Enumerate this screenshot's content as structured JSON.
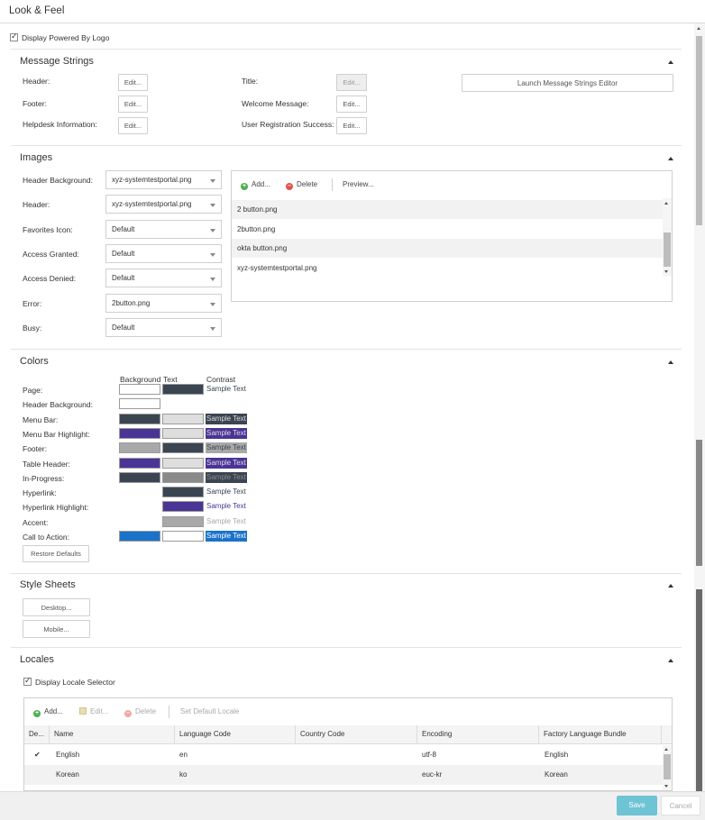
{
  "page": {
    "title": "Look & Feel"
  },
  "powered_by": {
    "label": "Display Powered By Logo",
    "checked": true
  },
  "message_strings": {
    "title": "Message Strings",
    "items": [
      {
        "label": "Header:",
        "button": "Edit...",
        "enabled": true
      },
      {
        "label": "Footer:",
        "button": "Edit...",
        "enabled": true
      },
      {
        "label": "Helpdesk Information:",
        "button": "Edit...",
        "enabled": true
      },
      {
        "label": "Title:",
        "button": "Edit...",
        "enabled": false
      },
      {
        "label": "Welcome Message:",
        "button": "Edit...",
        "enabled": true
      },
      {
        "label": "User Registration Success:",
        "button": "Edit...",
        "enabled": true
      }
    ],
    "launch_button": "Launch Message Strings Editor"
  },
  "images": {
    "title": "Images",
    "fields": [
      {
        "label": "Header Background:",
        "value": "xyz-systemtestportal.png"
      },
      {
        "label": "Header:",
        "value": "xyz-systemtestportal.png"
      },
      {
        "label": "Favorites Icon:",
        "value": "Default"
      },
      {
        "label": "Access Granted:",
        "value": "Default"
      },
      {
        "label": "Access Denied:",
        "value": "Default"
      },
      {
        "label": "Error:",
        "value": "2button.png"
      },
      {
        "label": "Busy:",
        "value": "Default"
      }
    ],
    "toolbar": {
      "add": "Add...",
      "delete": "Delete",
      "preview": "Preview..."
    },
    "files": [
      "2 button.png",
      "2button.png",
      "okta button.png",
      "xyz-systemtestportal.png"
    ]
  },
  "colors": {
    "title": "Colors",
    "headers": {
      "background": "Background",
      "text": "Text",
      "contrast": "Contrast"
    },
    "rows": [
      {
        "label": "Page:",
        "bg": "#ffffff",
        "fg": "#3b4552",
        "sample": "Sample Text",
        "sample_bg": "#ffffff",
        "sample_fg": "#3b4552"
      },
      {
        "label": "Header Background:",
        "bg": "#ffffff"
      },
      {
        "label": "Menu Bar:",
        "bg": "#3b4552",
        "fg": "#dedede",
        "sample": "Sample Text",
        "sample_bg": "#3b4552",
        "sample_fg": "#dedede"
      },
      {
        "label": "Menu Bar Highlight:",
        "bg": "#4a3496",
        "fg": "#dedede",
        "sample": "Sample Text",
        "sample_bg": "#4a3496",
        "sample_fg": "#dedede"
      },
      {
        "label": "Footer:",
        "bg": "#a8a8a8",
        "fg": "#3b4552",
        "sample": "Sample Text",
        "sample_bg": "#a8a8a8",
        "sample_fg": "#3b4552"
      },
      {
        "label": "Table Header:",
        "bg": "#4a3496",
        "fg": "#dedede",
        "sample": "Sample Text",
        "sample_bg": "#4a3496",
        "sample_fg": "#dedede"
      },
      {
        "label": "In-Progress:",
        "bg": "#3b4552",
        "fg": "#8a8a8a",
        "sample": "Sample Text",
        "sample_bg": "#3b4552",
        "sample_fg": "#8a8a8a"
      },
      {
        "label": "Hyperlink:",
        "fg": "#3b4552",
        "sample": "Sample Text",
        "sample_bg": "#ffffff",
        "sample_fg": "#3b4552"
      },
      {
        "label": "Hyperlink Highlight:",
        "fg": "#4a3496",
        "sample": "Sample Text",
        "sample_bg": "#ffffff",
        "sample_fg": "#4a3496"
      },
      {
        "label": "Accent:",
        "fg": "#a8a8a8",
        "sample": "Sample Text",
        "sample_bg": "#ffffff",
        "sample_fg": "#a8a8a8"
      },
      {
        "label": "Call to Action:",
        "bg": "#1a73c9",
        "fg": "#ffffff",
        "sample": "Sample Text",
        "sample_bg": "#1a73c9",
        "sample_fg": "#ffffff"
      }
    ],
    "restore_button": "Restore Defaults"
  },
  "style_sheets": {
    "title": "Style Sheets",
    "desktop": "Desktop...",
    "mobile": "Mobile..."
  },
  "locales": {
    "title": "Locales",
    "selector": {
      "label": "Display Locale Selector",
      "checked": true
    },
    "toolbar": {
      "add": "Add...",
      "edit": "Edit...",
      "delete": "Delete",
      "set_default": "Set Default Locale"
    },
    "columns": [
      "De...",
      "Name",
      "Language Code",
      "Country Code",
      "Encoding",
      "Factory Language Bundle"
    ],
    "rows": [
      {
        "default": "✔",
        "name": "English",
        "lang": "en",
        "country": "",
        "encoding": "utf-8",
        "bundle": "English"
      },
      {
        "default": "",
        "name": "Korean",
        "lang": "ko",
        "country": "",
        "encoding": "euc-kr",
        "bundle": "Korean"
      }
    ]
  },
  "footer": {
    "save": "Save",
    "cancel": "Cancel"
  }
}
